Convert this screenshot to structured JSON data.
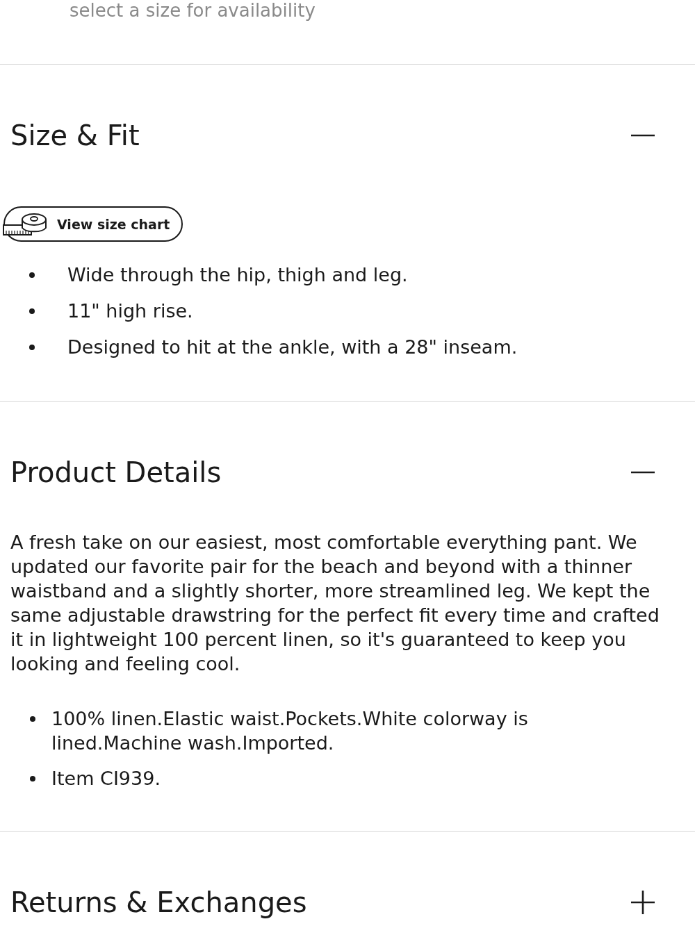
{
  "availability_note": "select a size for availability",
  "sections": [
    {
      "title": "Size & Fit",
      "expanded": true,
      "size_chart_button": "View size chart",
      "bullets": [
        "Wide through the hip, thigh and leg.",
        "11\" high rise.",
        "Designed to hit at the ankle, with a 28\" inseam."
      ]
    },
    {
      "title": "Product Details",
      "expanded": true,
      "description": "A fresh take on our easiest, most comfortable everything pant. We updated our favorite pair for the beach and beyond with a thinner waistband and a slightly shorter, more streamlined leg. We kept the same adjustable drawstring for the perfect fit every time and crafted it in lightweight 100 percent linen, so it's guaranteed to keep you looking and feeling cool.",
      "bullets": [
        "100% linen.Elastic waist.Pockets.White colorway is lined.Machine wash.Imported.",
        "Item CI939."
      ]
    },
    {
      "title": "Returns & Exchanges",
      "expanded": false
    }
  ]
}
